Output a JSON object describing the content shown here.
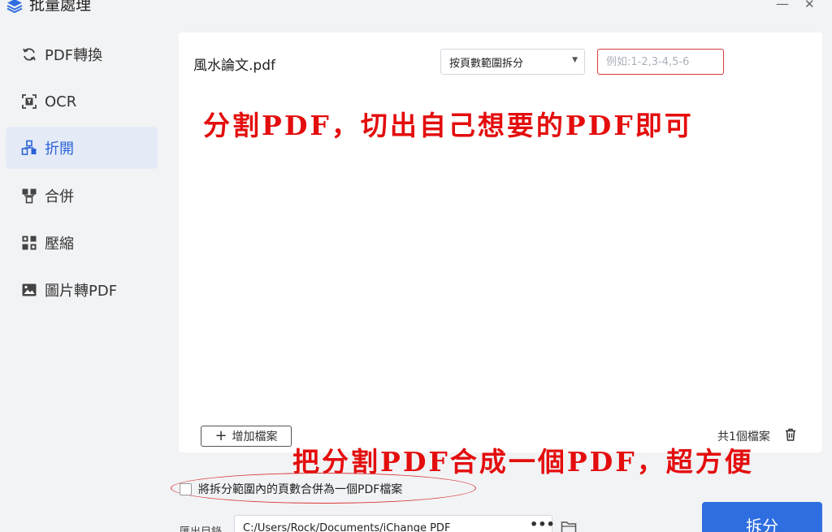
{
  "window": {
    "title": "批量處理",
    "minimize_glyph": "—",
    "close_glyph": "✕"
  },
  "sidebar": {
    "items": [
      {
        "label": "PDF轉換",
        "icon": "refresh-icon"
      },
      {
        "label": "OCR",
        "icon": "ocr-scan-icon"
      },
      {
        "label": "折開",
        "icon": "split-icon",
        "active": true
      },
      {
        "label": "合併",
        "icon": "merge-icon"
      },
      {
        "label": "壓縮",
        "icon": "compress-icon"
      },
      {
        "label": "圖片轉PDF",
        "icon": "image-icon"
      }
    ]
  },
  "file": {
    "name": "風水論文.pdf",
    "mode": "按頁數範圍拆分",
    "range_placeholder": "例如:1-2,3-4,5-6"
  },
  "annotations": {
    "top": "分割PDF，切出自己想要的PDF即可",
    "bottom": "把分割PDF合成一個PDF，超方便"
  },
  "panel_footer": {
    "add_label": "增加檔案",
    "count_label": "共1個檔案"
  },
  "merge_option": {
    "label": "將拆分範圍內的頁數合併為一個PDF檔案"
  },
  "output": {
    "label": "匯出目錄",
    "path": "C:/Users/Rock/Documents/iChange PDF",
    "dots": "•••"
  },
  "split_button": "拆分",
  "colors": {
    "accent": "#2f6ee0",
    "active_bg": "#e4ebf7",
    "annotation_red": "#e40d0d"
  }
}
